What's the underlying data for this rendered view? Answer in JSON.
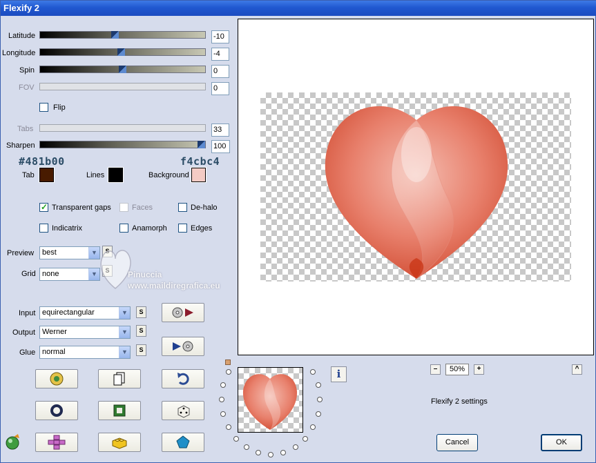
{
  "window": {
    "title": "Flexify 2"
  },
  "sliders": [
    {
      "name": "latitude",
      "label": "Latitude",
      "value": "-10",
      "level": 0.45,
      "disabled": false
    },
    {
      "name": "longitude",
      "label": "Longitude",
      "value": "-4",
      "level": 0.49,
      "disabled": false
    },
    {
      "name": "spin",
      "label": "Spin",
      "value": "0",
      "level": 0.5,
      "disabled": false
    },
    {
      "name": "fov",
      "label": "FOV",
      "value": "0",
      "level": 0,
      "disabled": true
    },
    {
      "name": "tabs",
      "label": "Tabs",
      "value": "33",
      "level": 0,
      "disabled": true
    },
    {
      "name": "sharpen",
      "label": "Sharpen",
      "value": "100",
      "level": 1.0,
      "disabled": false
    }
  ],
  "flip": {
    "label": "Flip",
    "checked": false
  },
  "colors": {
    "tab_hex_label": "#481b00",
    "background_hex_label": "f4cbc4",
    "tab_label": "Tab",
    "lines_label": "Lines",
    "background_label": "Background",
    "tab_color": "#481b00",
    "lines_color": "#000000",
    "background_color": "#f4cbc4",
    "hex_text_color": "#2b4c66"
  },
  "options": {
    "transparent_gaps": {
      "label": "Transparent gaps",
      "checked": true,
      "disabled": false
    },
    "faces": {
      "label": "Faces",
      "checked": false,
      "disabled": true
    },
    "de_halo": {
      "label": "De-halo",
      "checked": false,
      "disabled": false
    },
    "indicatrix": {
      "label": "Indicatrix",
      "checked": false,
      "disabled": false
    },
    "anamorph": {
      "label": "Anamorph",
      "checked": false,
      "disabled": false
    },
    "edges": {
      "label": "Edges",
      "checked": false,
      "disabled": false
    }
  },
  "preview_select": {
    "label": "Preview",
    "value": "best"
  },
  "grid_select": {
    "label": "Grid",
    "value": "none"
  },
  "input_select": {
    "label": "Input",
    "value": "equirectangular"
  },
  "output_select": {
    "label": "Output",
    "value": "Werner"
  },
  "glue_select": {
    "label": "Glue",
    "value": "normal"
  },
  "s_button_label": "S",
  "watermark": {
    "name": "Pinuccia",
    "url": "www.maildiregrafica.eu"
  },
  "zoom": {
    "minus": "–",
    "value": "50%",
    "plus": "+",
    "up": "^"
  },
  "info_label": "i",
  "settings_label": "Flexify 2 settings",
  "buttons": {
    "cancel": "Cancel",
    "ok": "OK"
  }
}
